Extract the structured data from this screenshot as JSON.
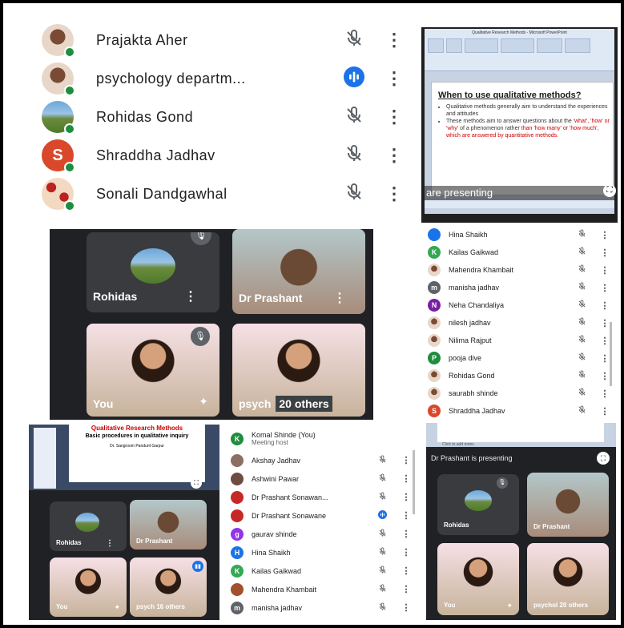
{
  "top_left_list": [
    {
      "name": "Prajakta Aher",
      "icon": "mic-off-icon",
      "avatar": "photo"
    },
    {
      "name": "psychology departm...",
      "icon": "speaking-icon",
      "avatar": "photo"
    },
    {
      "name": "Rohidas Gond",
      "icon": "mic-off-icon",
      "avatar": "landscape"
    },
    {
      "name": "Shraddha Jadhav",
      "icon": "mic-off-icon",
      "avatar": "letter",
      "letter": "S",
      "color": "#d9482b"
    },
    {
      "name": "Sonali Dandgawhal",
      "icon": "mic-off-icon",
      "avatar": "pattern"
    }
  ],
  "top_right_slide": {
    "window_title": "Qualitative Research Methods - Microsoft PowerPoint",
    "heading": "When to use qualitative methods?",
    "bullet1": "Qualitative methods generally aim to understand the experiences and attitudes",
    "bullet2_a": "These methods aim to answer questions about the ",
    "bullet2_b": "'what', 'how' or 'why'",
    "bullet2_c": " of a phenomenon rather ",
    "bullet2_d": "than 'how many' or 'how much', which are answered by quantitative methods.",
    "presenting": "are presenting"
  },
  "mid_left_grid": {
    "tile1": "Rohidas",
    "tile2": "Dr Prashant",
    "tile3": "You",
    "tile4": "psych",
    "others": "20 others"
  },
  "mid_right_list": [
    {
      "name": "Hina Shaikh",
      "letter": "",
      "color": "#1a73e8",
      "partial": true
    },
    {
      "name": "Kailas Gaikwad",
      "letter": "K",
      "color": "#34a853"
    },
    {
      "name": "Mahendra Khambait",
      "letter": "",
      "color": "#a0522d",
      "photo": true
    },
    {
      "name": "manisha jadhav",
      "letter": "m",
      "color": "#5f6368"
    },
    {
      "name": "Neha Chandaliya",
      "letter": "N",
      "color": "#7b1fa2"
    },
    {
      "name": "nilesh jadhav",
      "letter": "",
      "color": "#8d6e63",
      "photo": true
    },
    {
      "name": "Nilima Rajput",
      "letter": "",
      "color": "#c62828",
      "photo": true
    },
    {
      "name": "pooja dive",
      "letter": "P",
      "color": "#1e8e3e"
    },
    {
      "name": "Rohidas Gond",
      "letter": "",
      "color": "#6d8b3d",
      "photo": true
    },
    {
      "name": "saurabh shinde",
      "letter": "",
      "color": "#9e9e9e",
      "photo": true
    },
    {
      "name": "Shraddha Jadhav",
      "letter": "S",
      "color": "#d9482b",
      "partial": true
    }
  ],
  "bottom_left": {
    "slide_title": "Qualitative Research Methods",
    "slide_sub": "Basic procedures in qualitative inquiry",
    "presenter_line": "Dr. Sangroom Pandurit Garpur",
    "grid_tile1": "Rohidas",
    "grid_tile2": "Dr Prashant",
    "grid_tile3": "You",
    "grid_tile4": "psych",
    "others": "16 others"
  },
  "bottom_mid_list": [
    {
      "name": "Komal Shinde (You)",
      "sub": "Meeting host",
      "letter": "K",
      "color": "#1e8e3e",
      "icon": ""
    },
    {
      "name": "Akshay Jadhav",
      "letter": "",
      "color": "#8d6e63",
      "icon": "mic-off"
    },
    {
      "name": "Ashwini Pawar",
      "letter": "",
      "color": "#6d4c41",
      "icon": "mic-off"
    },
    {
      "name": "Dr Prashant Sonawan...",
      "letter": "",
      "color": "#c62828",
      "icon": "mic-off"
    },
    {
      "name": "Dr Prashant Sonawane",
      "letter": "",
      "color": "#c62828",
      "icon": "speaking"
    },
    {
      "name": "gaurav shinde",
      "letter": "g",
      "color": "#9334e6",
      "icon": "mic-off"
    },
    {
      "name": "Hina Shaikh",
      "letter": "H",
      "color": "#1a73e8",
      "icon": "mic-off"
    },
    {
      "name": "Kailas Gaikwad",
      "letter": "K",
      "color": "#34a853",
      "icon": "mic-off"
    },
    {
      "name": "Mahendra Khambait",
      "letter": "",
      "color": "#a0522d",
      "icon": "mic-off"
    },
    {
      "name": "manisha jadhav",
      "letter": "m",
      "color": "#5f6368",
      "icon": "mic-off"
    }
  ],
  "bottom_right": {
    "presenting": "Dr Prashant is presenting",
    "click_note": "Click to add notes",
    "grid_tile1": "Rohidas",
    "grid_tile2": "Dr Prashant",
    "grid_tile3": "You",
    "grid_tile4": "psychol",
    "others": "20 others"
  }
}
